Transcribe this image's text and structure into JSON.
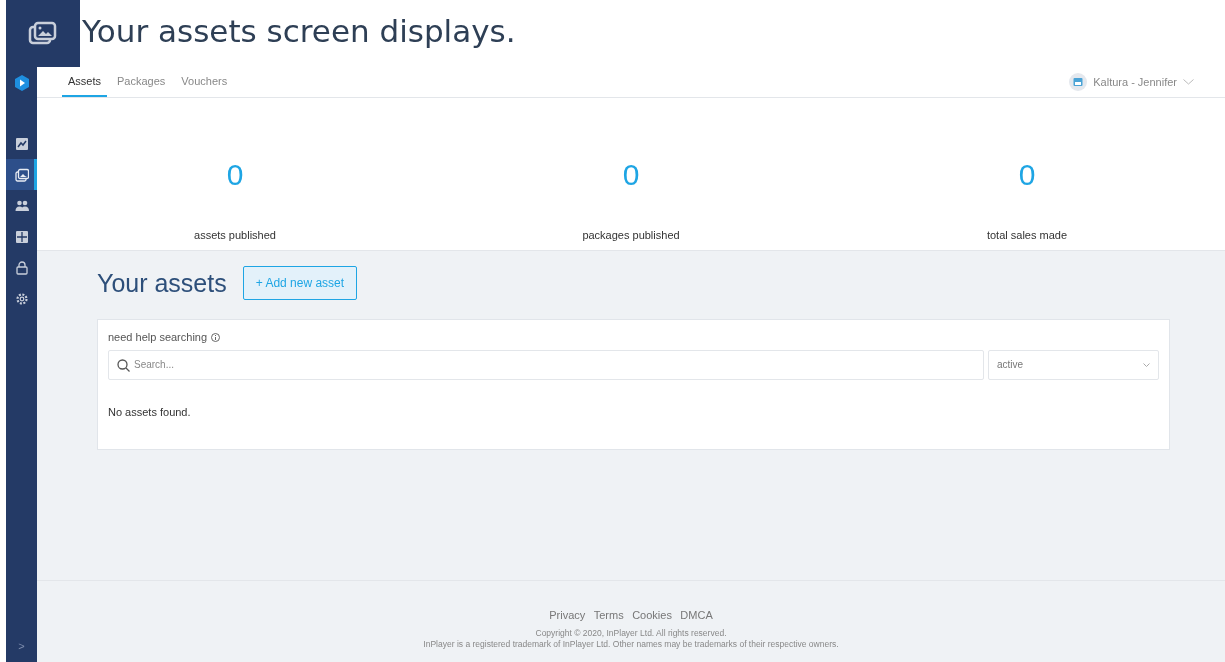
{
  "caption": {
    "text": "Your assets screen displays."
  },
  "sidebar": {
    "items": [
      {
        "kind": "chart",
        "selected": false
      },
      {
        "kind": "assets",
        "selected": true
      },
      {
        "kind": "users",
        "selected": false
      },
      {
        "kind": "grid",
        "selected": false
      },
      {
        "kind": "lock",
        "selected": false
      },
      {
        "kind": "gear",
        "selected": false
      }
    ],
    "expand": ">"
  },
  "tabs": [
    {
      "label": "Assets",
      "selected": true
    },
    {
      "label": "Packages",
      "selected": false
    },
    {
      "label": "Vouchers",
      "selected": false
    }
  ],
  "account": {
    "name": "Kaltura - Jennifer"
  },
  "stats": [
    {
      "value": "0",
      "label": "assets published"
    },
    {
      "value": "0",
      "label": "packages published"
    },
    {
      "value": "0",
      "label": "total sales made"
    }
  ],
  "heading": "Your assets",
  "add_button": "+ Add new asset",
  "help_label": "need help searching",
  "search": {
    "placeholder": "Search..."
  },
  "status_filter": {
    "value": "active"
  },
  "empty_message": "No assets found.",
  "footer": {
    "links": [
      "Privacy",
      "Terms",
      "Cookies",
      "DMCA"
    ],
    "copyright": "Copyright © 2020, InPlayer Ltd. All rights reserved.",
    "trademark": "InPlayer is a registered trademark of InPlayer Ltd. Other names may be trademarks of their respective owners."
  }
}
